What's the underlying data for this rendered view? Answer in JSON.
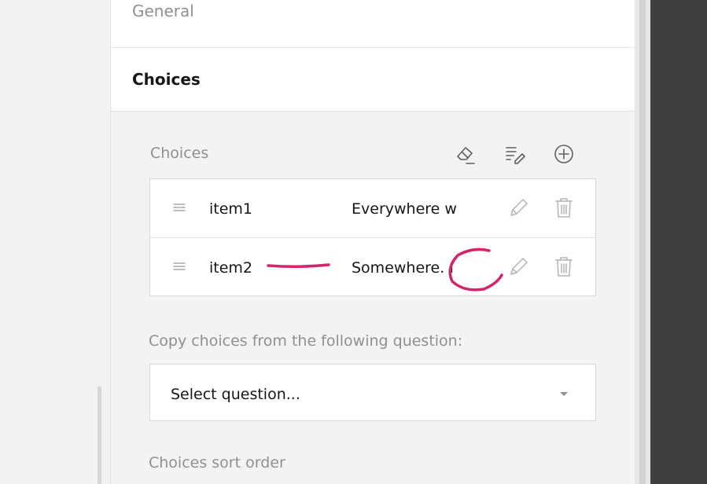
{
  "panel": {
    "general_title": "General",
    "choices_title": "Choices"
  },
  "choices_editor": {
    "label": "Choices",
    "toolbar_icons": [
      "eraser-icon",
      "edit-list-icon",
      "plus-circle-icon"
    ],
    "items": [
      {
        "value": "item1",
        "text": "Everywhere w"
      },
      {
        "value": "item2",
        "text": "Somewhere. I"
      }
    ]
  },
  "copy_choices": {
    "label": "Copy choices from the following question:",
    "select_value": "Select question..."
  },
  "sort_order": {
    "label": "Choices sort order"
  },
  "colors": {
    "annotation": "#d4246b",
    "dark_panel": "#3f3f3f",
    "muted_text": "#909090"
  }
}
